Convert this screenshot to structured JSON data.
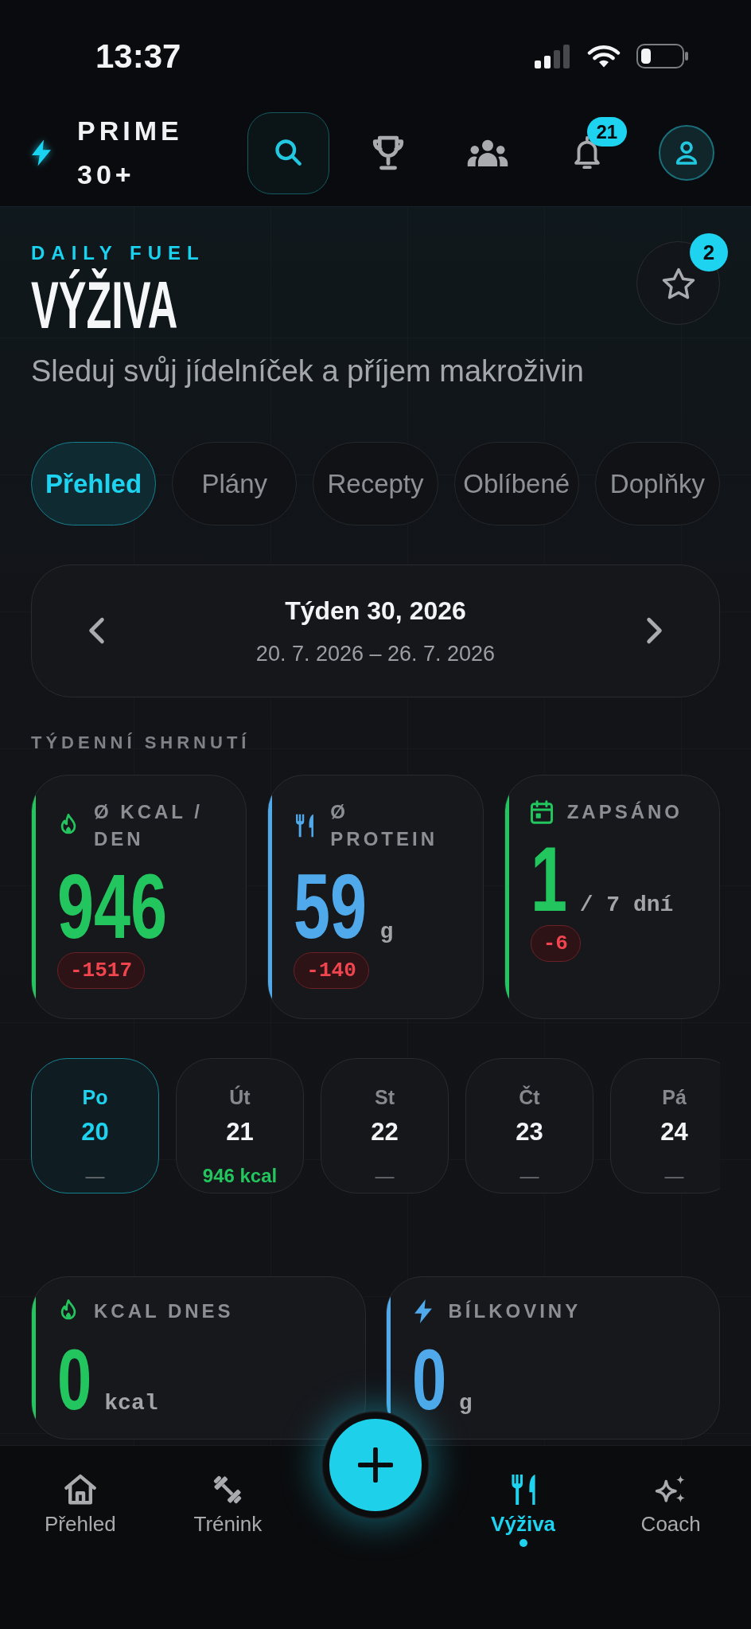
{
  "status_bar": {
    "time": "13:37"
  },
  "header": {
    "brand": "PRIME 30+",
    "actions": [
      {
        "kind": "search"
      },
      {
        "kind": "trophy"
      },
      {
        "kind": "group"
      },
      {
        "kind": "bell",
        "badge": "21"
      },
      {
        "kind": "profile"
      }
    ]
  },
  "page": {
    "eyebrow": "DAILY FUEL",
    "title": "VÝŽIVA",
    "subtitle": "Sleduj svůj jídelníček a příjem makroživin",
    "favorites_badge": "2"
  },
  "tabs": [
    {
      "label": "Přehled",
      "selected": true
    },
    {
      "label": "Plány",
      "selected": false
    },
    {
      "label": "Recepty",
      "selected": false
    },
    {
      "label": "Oblíbené",
      "selected": false
    },
    {
      "label": "Doplňky",
      "selected": false
    }
  ],
  "week": {
    "title": "Týden 30, 2026",
    "range": "20. 7. 2026 – 26. 7. 2026"
  },
  "summary": {
    "heading": "TÝDENNÍ SHRNUTÍ",
    "cards": [
      {
        "kind": "flame",
        "label": "Ø KCAL / DEN",
        "value": "946",
        "delta": "-1517",
        "color": "#22c55e"
      },
      {
        "kind": "cutlery",
        "label": "Ø PROTEIN",
        "value": "59",
        "unit": "g",
        "delta": "-140",
        "color": "#4fa9ea"
      },
      {
        "kind": "calendar",
        "label": "ZAPSÁNO",
        "value": "1",
        "unit": "/ 7 dní",
        "delta": "-6",
        "color": "#22c55e"
      }
    ]
  },
  "days": [
    {
      "weekday": "Po",
      "day": "20",
      "note": "—",
      "selected": true,
      "logged": false
    },
    {
      "weekday": "Út",
      "day": "21",
      "note": "946 kcal",
      "selected": false,
      "logged": true
    },
    {
      "weekday": "St",
      "day": "22",
      "note": "—",
      "selected": false,
      "logged": false
    },
    {
      "weekday": "Čt",
      "day": "23",
      "note": "—",
      "selected": false,
      "logged": false
    },
    {
      "weekday": "Pá",
      "day": "24",
      "note": "—",
      "selected": false,
      "logged": false
    }
  ],
  "today": [
    {
      "kind": "flame",
      "label": "KCAL DNES",
      "value": "0",
      "unit": "kcal",
      "color": "#22c55e"
    },
    {
      "kind": "bolt",
      "label": "BÍLKOVINY",
      "value": "0",
      "unit": "g",
      "color": "#4fa9ea"
    }
  ],
  "nav": [
    {
      "kind": "home",
      "label": "Přehled",
      "selected": false
    },
    {
      "kind": "dumbbell",
      "label": "Trénink",
      "selected": false
    },
    {
      "kind": "cutlery",
      "label": "Výživa",
      "selected": true
    },
    {
      "kind": "sparkles",
      "label": "Coach",
      "selected": false
    }
  ]
}
